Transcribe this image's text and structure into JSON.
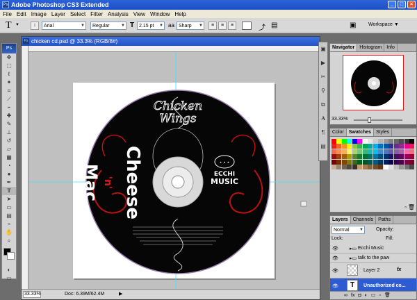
{
  "window": {
    "title": "Adobe Photoshop CS3 Extended",
    "app_icon": "Ps",
    "min": "_",
    "max": "□",
    "close": "×"
  },
  "menu": [
    "File",
    "Edit",
    "Image",
    "Layer",
    "Select",
    "Filter",
    "Analysis",
    "View",
    "Window",
    "Help"
  ],
  "options": {
    "tool_glyph": "T",
    "font": "Arial",
    "style": "Regular",
    "size": "2.15 pt",
    "aa": "Sharp",
    "workspace": "Workspace ▼"
  },
  "toolbox": {
    "logo": "Ps"
  },
  "document": {
    "title": "chicken cd.psd @ 33.3% (RGB/8#)",
    "icon": "Ps",
    "zoom": "33.33%",
    "doc_size": "Doc: 6.39M/62.4M"
  },
  "artwork": {
    "top_text_1": "Chicken",
    "top_text_2": "Wings",
    "left_text": "Mac",
    "mid_text": "'n'",
    "cheese": "Cheese",
    "logo_line1": "ECCHI",
    "logo_line2": "MUSIC"
  },
  "navigator": {
    "tabs": [
      "Navigator",
      "Histogram",
      "Info"
    ],
    "zoom": "33.33%",
    "slider_value": 0.3
  },
  "swatches": {
    "tabs": [
      "Color",
      "Swatches",
      "Styles"
    ],
    "colors": [
      "#ff0000",
      "#ffff00",
      "#00ff00",
      "#00ffff",
      "#0000ff",
      "#ff00ff",
      "#ffffff",
      "#e6e6e6",
      "#cccccc",
      "#b3b3b3",
      "#999999",
      "#808080",
      "#666666",
      "#4d4d4d",
      "#333333",
      "#000000",
      "#ed1c24",
      "#f26522",
      "#f7941d",
      "#fff200",
      "#8dc63f",
      "#39b54a",
      "#00a651",
      "#00a99d",
      "#00aeef",
      "#0072bc",
      "#0054a6",
      "#2e3192",
      "#662d91",
      "#92278f",
      "#ec008c",
      "#ed145b",
      "#f26c4f",
      "#f68e56",
      "#fbaf5d",
      "#fff467",
      "#acd372",
      "#7cc576",
      "#3bb878",
      "#1abbb4",
      "#00bff3",
      "#438ccb",
      "#5574b9",
      "#605ca8",
      "#855fa8",
      "#a763a8",
      "#f06ea9",
      "#f26d7d",
      "#9e0b0f",
      "#a0410d",
      "#a36209",
      "#aba000",
      "#598527",
      "#1a7b30",
      "#007236",
      "#00746b",
      "#0076a3",
      "#004b80",
      "#003471",
      "#1b1464",
      "#440e62",
      "#630460",
      "#9e005d",
      "#9e0039",
      "#790000",
      "#7b2e00",
      "#7d4900",
      "#827b00",
      "#406618",
      "#005e20",
      "#005826",
      "#005952",
      "#005b7f",
      "#003663",
      "#002157",
      "#0d004c",
      "#32004b",
      "#4b0049",
      "#7b0046",
      "#7a0026",
      "#c7b299",
      "#998675",
      "#736357",
      "#534741",
      "#37302d",
      "#c69c6d",
      "#a67c52",
      "#8c6239",
      "#754c24",
      "#603913",
      "#ffffff",
      "#e0e0e0",
      "#bcbcbc",
      "#969696",
      "#707070",
      "#4a4a4a"
    ]
  },
  "layers": {
    "tabs": [
      "Layers",
      "Channels",
      "Paths"
    ],
    "blend": "Normal",
    "opacity_label": "Opacity:",
    "lock_label": "Lock:",
    "fill_label": "Fill:",
    "rows": [
      {
        "name": "Ecchi Music",
        "type": "group"
      },
      {
        "name": "talk to the paw",
        "type": "group"
      },
      {
        "name": "Layer 2",
        "type": "layer",
        "fx": "fx"
      },
      {
        "name": "Unauthorized co...",
        "type": "text",
        "thumb": "T",
        "active": true
      }
    ]
  }
}
